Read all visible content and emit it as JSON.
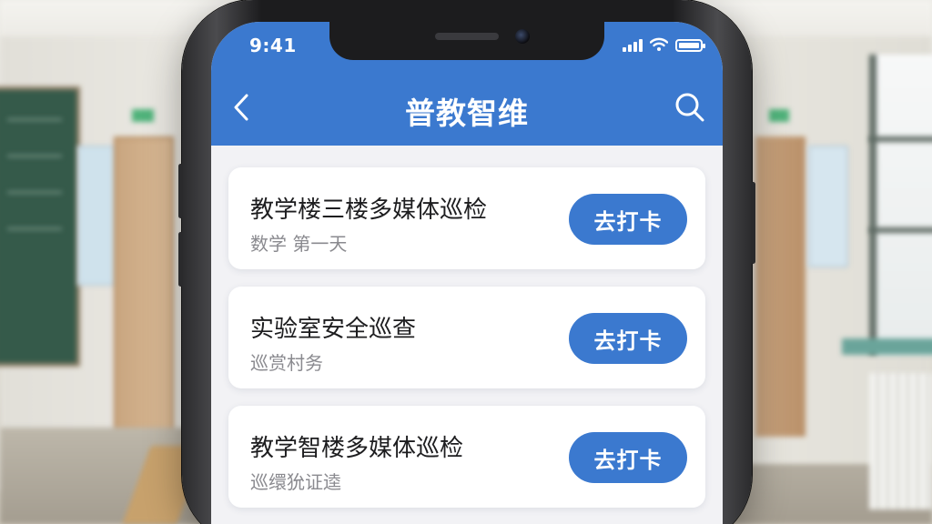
{
  "status_bar": {
    "time": "9:41"
  },
  "header": {
    "title": "普教智维",
    "back_icon": "chevron-left-icon",
    "search_icon": "search-icon"
  },
  "tasks": [
    {
      "title": "教学楼三楼多媒体巡检",
      "subtitle": "数学 第一天",
      "action": "去打卡"
    },
    {
      "title": "实验室安全巡查",
      "subtitle": "巡赏村务",
      "action": "去打卡"
    },
    {
      "title": "教学智楼多媒体巡检",
      "subtitle": "巡缳狁证逵",
      "action": "去打卡"
    }
  ],
  "colors": {
    "accent": "#3b79cf",
    "card_bg": "#ffffff",
    "screen_bg": "#f2f2f5"
  }
}
